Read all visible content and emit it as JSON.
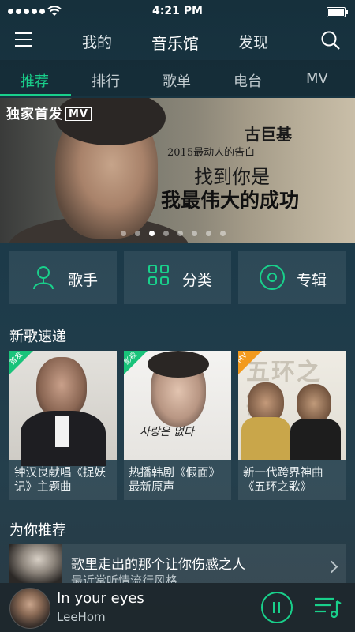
{
  "status": {
    "time": "4:21 PM"
  },
  "header": {
    "tabs": [
      {
        "label": "我的"
      },
      {
        "label": "音乐馆"
      },
      {
        "label": "发现"
      }
    ]
  },
  "subtabs": [
    {
      "label": "推荐"
    },
    {
      "label": "排行"
    },
    {
      "label": "歌单"
    },
    {
      "label": "电台"
    },
    {
      "label": "MV"
    }
  ],
  "banner": {
    "exclusive": "独家首发",
    "exclusive_badge": "MV",
    "artist": "古巨基",
    "subtitle": "2015最动人的告白",
    "line1": "找到你是",
    "line2": "我最伟大的成功",
    "page_count": 8,
    "active_page": 3
  },
  "categories": [
    {
      "label": "歌手",
      "icon": "singer-icon"
    },
    {
      "label": "分类",
      "icon": "grid-icon"
    },
    {
      "label": "专辑",
      "icon": "disc-icon"
    }
  ],
  "new_songs": {
    "title": "新歌速递",
    "items": [
      {
        "tag": "首发",
        "text": "钟汉良献唱《捉妖记》主题曲"
      },
      {
        "tag": "影视",
        "text": "热播韩剧《假面》最新原声"
      },
      {
        "tag": "MV",
        "text": "新一代跨界神曲《五环之歌》"
      }
    ]
  },
  "recommend": {
    "title": "为你推荐",
    "item_title": "歌里走出的那个让你伤感之人",
    "item_sub": "最近常听情流行风格"
  },
  "player": {
    "song": "In your eyes",
    "artist": "LeeHom"
  },
  "colors": {
    "accent": "#19d08b"
  }
}
